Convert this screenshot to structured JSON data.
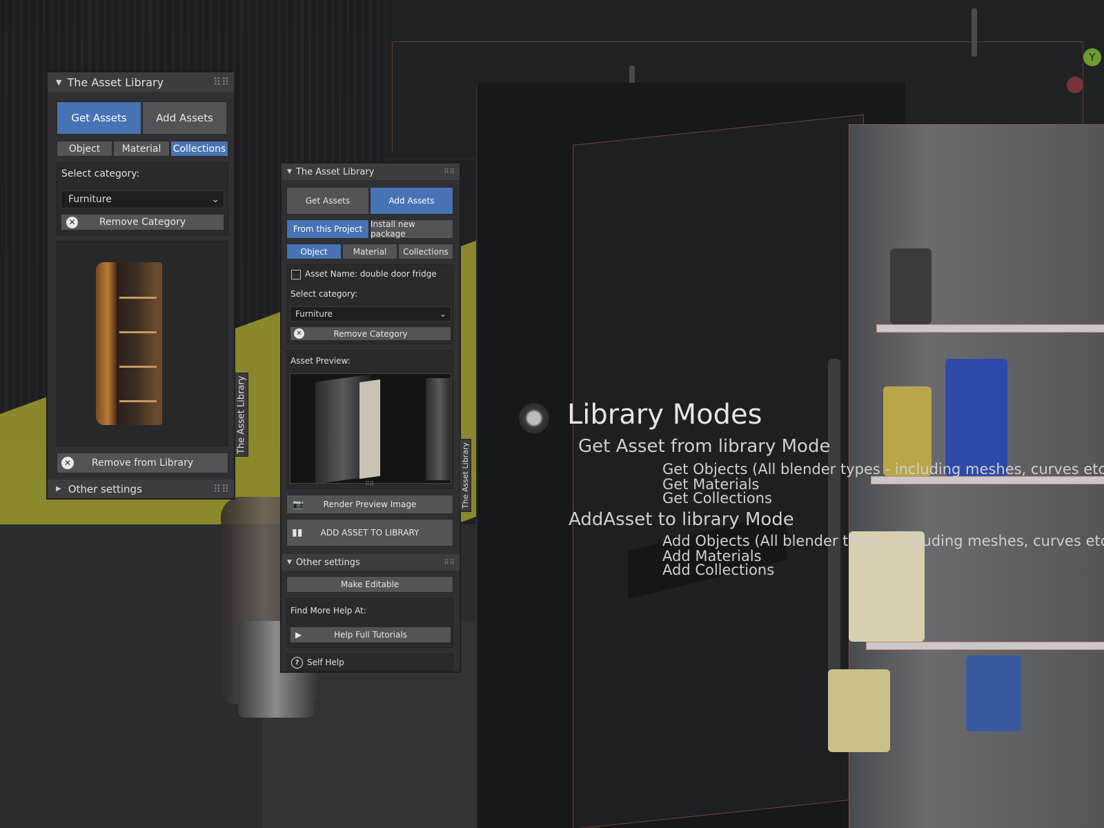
{
  "panel_get": {
    "title": "The Asset Library",
    "tabs": [
      "Get Assets",
      "Add Assets"
    ],
    "active_tab": "Get Assets",
    "types": [
      "Object",
      "Material",
      "Collections"
    ],
    "active_type": "Collections",
    "select_category_label": "Select category:",
    "category_value": "Furniture",
    "remove_category_label": "Remove Category",
    "remove_library_label": "Remove from Library",
    "other_settings_label": "Other settings",
    "side_tab_label": "The Asset Library"
  },
  "panel_add": {
    "title": "The Asset Library",
    "tabs": [
      "Get Assets",
      "Add Assets"
    ],
    "active_tab": "Add Assets",
    "source_tabs": [
      "From this Project",
      "Install new package"
    ],
    "active_source": "From this Project",
    "types": [
      "Object",
      "Material",
      "Collections"
    ],
    "active_type": "Object",
    "asset_name_label": "Asset Name: double door fridge",
    "select_category_label": "Select category:",
    "category_value": "Furniture",
    "remove_category_label": "Remove Category",
    "asset_preview_label": "Asset Preview:",
    "render_preview_label": "Render Preview Image",
    "add_asset_label": "ADD ASSET TO LIBRARY",
    "other_settings_label": "Other settings",
    "make_editable_label": "Make Editable",
    "find_help_label": "Find More Help At:",
    "help_tutorials_label": "Help Full Tutorials",
    "self_help_label": "Self Help",
    "side_tab_label": "The Asset Library"
  },
  "annotation": {
    "title": "Library Modes",
    "get_mode": "Get Asset from library Mode",
    "get_items": [
      "Get Objects (All blender types - including meshes, curves etc)",
      "Get Materials",
      "Get Collections"
    ],
    "add_mode": "AddAsset to library Mode",
    "add_items": [
      "Add Objects (All blender types - including meshes, curves etc)",
      "Add  Materials",
      "Add Collections"
    ]
  },
  "gizmo": {
    "y_axis_label": "Y"
  },
  "colors": {
    "accent": "#4772b3",
    "panel_bg": "#303032",
    "button_bg": "#545456"
  }
}
